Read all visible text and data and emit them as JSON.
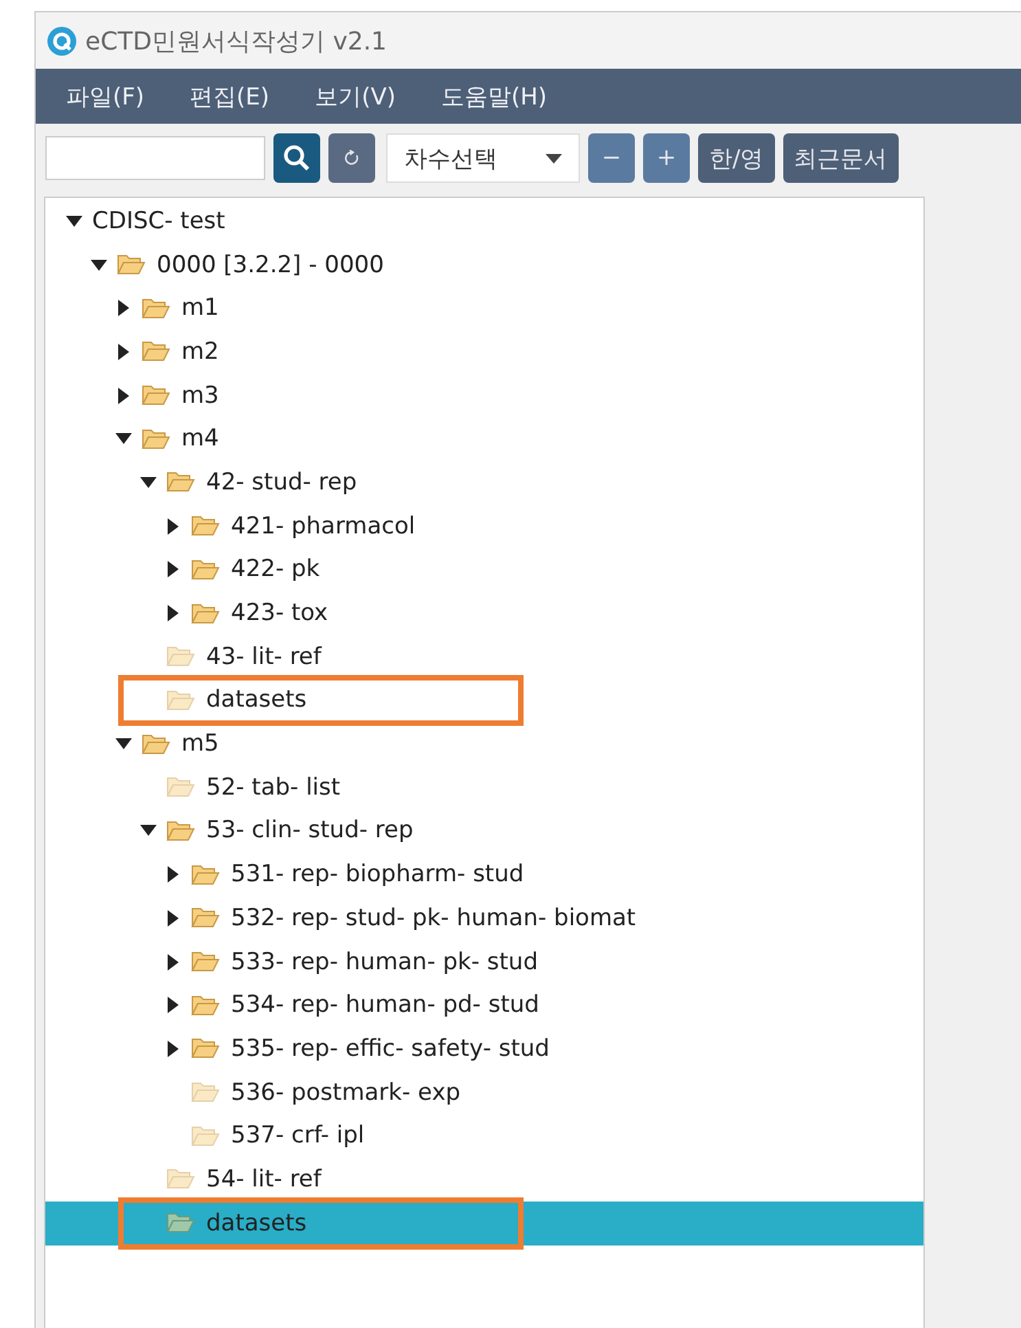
{
  "window": {
    "title": "eCTD민원서식작성기 v2.1"
  },
  "menu": [
    "파일(F)",
    "편집(E)",
    "보기(V)",
    "도움말(H)"
  ],
  "toolbar": {
    "version_select": {
      "value": "차수선택"
    },
    "buttons": [
      {
        "kind": "minus",
        "label": "−"
      },
      {
        "kind": "plus",
        "label": "+"
      },
      {
        "kind": "text",
        "label": "한/영"
      },
      {
        "kind": "text",
        "label": "최근문서"
      }
    ]
  },
  "tree": [
    {
      "label": "CDISC- test",
      "expanded": true,
      "selected": false,
      "highlighted": false,
      "children": [
        {
          "label": "0000 [3.2.2] -  0000",
          "expanded": true,
          "selected": false,
          "highlighted": false,
          "children": [
            {
              "label": "m1",
              "expanded": false,
              "selected": false,
              "highlighted": false
            },
            {
              "label": "m2",
              "expanded": false,
              "selected": false,
              "highlighted": false
            },
            {
              "label": "m3",
              "expanded": false,
              "selected": false,
              "highlighted": false
            },
            {
              "label": "m4",
              "expanded": true,
              "selected": false,
              "highlighted": false,
              "children": [
                {
                  "label": "42- stud- rep",
                  "expanded": true,
                  "selected": false,
                  "highlighted": false,
                  "children": [
                    {
                      "label": "421- pharmacol",
                      "expanded": false,
                      "selected": false,
                      "highlighted": false
                    },
                    {
                      "label": "422- pk",
                      "expanded": false,
                      "selected": false,
                      "highlighted": false
                    },
                    {
                      "label": "423- tox",
                      "expanded": false,
                      "selected": false,
                      "highlighted": false
                    }
                  ]
                },
                {
                  "label": "43- lit- ref",
                  "selected": false,
                  "highlighted": false
                },
                {
                  "label": "datasets",
                  "selected": false,
                  "highlighted": true
                }
              ]
            },
            {
              "label": "m5",
              "expanded": true,
              "selected": false,
              "highlighted": false,
              "children": [
                {
                  "label": "52- tab- list",
                  "selected": false,
                  "highlighted": false
                },
                {
                  "label": "53- clin- stud- rep",
                  "expanded": true,
                  "selected": false,
                  "highlighted": false,
                  "children": [
                    {
                      "label": "531- rep- biopharm- stud",
                      "expanded": false,
                      "selected": false,
                      "highlighted": false
                    },
                    {
                      "label": "532- rep- stud- pk- human- biomat",
                      "expanded": false,
                      "selected": false,
                      "highlighted": false
                    },
                    {
                      "label": "533- rep- human- pk- stud",
                      "expanded": false,
                      "selected": false,
                      "highlighted": false
                    },
                    {
                      "label": "534- rep- human- pd- stud",
                      "expanded": false,
                      "selected": false,
                      "highlighted": false
                    },
                    {
                      "label": "535- rep- effic- safety- stud",
                      "expanded": false,
                      "selected": false,
                      "highlighted": false
                    },
                    {
                      "label": "536- postmark- exp",
                      "selected": false,
                      "highlighted": false
                    },
                    {
                      "label": "537- crf- ipl",
                      "selected": false,
                      "highlighted": false
                    }
                  ]
                },
                {
                  "label": "54- lit- ref",
                  "selected": false,
                  "highlighted": false
                },
                {
                  "label": "datasets",
                  "selected": true,
                  "highlighted": true
                }
              ]
            }
          ]
        }
      ]
    }
  ]
}
